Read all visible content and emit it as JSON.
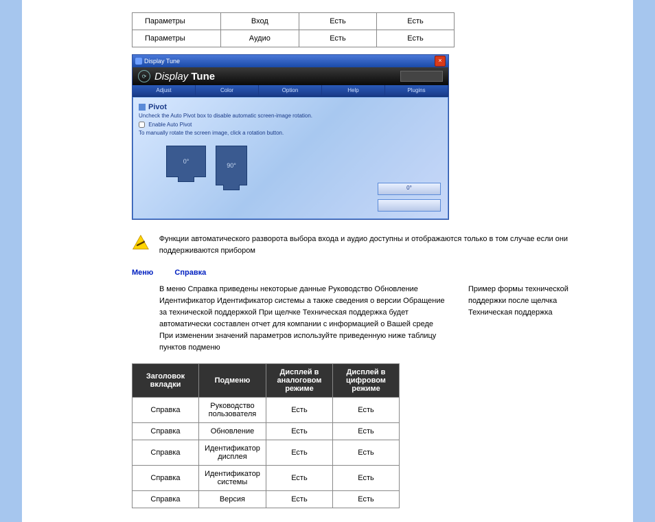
{
  "table1": {
    "rows": [
      {
        "c0": "Параметры",
        "c1": "Вход",
        "c2": "Есть",
        "c3": "Есть"
      },
      {
        "c0": "Параметры",
        "c1": "Аудио",
        "c2": "Есть",
        "c3": "Есть"
      }
    ]
  },
  "app": {
    "title": "Display Tune",
    "brand_prefix": "Display",
    "brand_suffix": "Tune",
    "tabs": [
      "Adjust",
      "Color",
      "Option",
      "Help",
      "Plugins"
    ],
    "panel_title": "Pivot",
    "panel_desc": "Uncheck the Auto Pivot box to disable automatic screen-image rotation.",
    "checkbox": "Enable Auto Pivot",
    "panel_hint": "To manually rotate the screen image, click a rotation button.",
    "mon1": "0°",
    "mon2": "90°",
    "btn1": "0°",
    "btn2": ""
  },
  "warning": "Функции автоматического разворота  выбора входа и аудио доступны и отображаются только в том случае  если они поддерживаются прибором",
  "menu": {
    "m1": "Меню",
    "m2": "Справка"
  },
  "col_left": "В меню          Справка  приведены некоторые данные               Руководство              Обновление         Идентификатор         Идентификатор системы   а также сведения о версии   Обращение за технической поддержкой  При щелчке               Техническая поддержка  будет автоматически составлен отчет для компании          с информацией о Вашей среде   При изменении значений параметров используйте приведенную ниже таблицу пунктов подменю",
  "col_right": "Пример формы технической поддержки после щелчка                    Техническая поддержка",
  "table2": {
    "headers": [
      "Заголовок вкладки",
      "Подменю",
      "Дисплей в аналоговом режиме",
      "Дисплей в цифровом режиме"
    ],
    "rows": [
      {
        "c0": "Справка",
        "c1": "Руководство пользователя",
        "c2": "Есть",
        "c3": "Есть"
      },
      {
        "c0": "Справка",
        "c1": "Обновление",
        "c2": "Есть",
        "c3": "Есть"
      },
      {
        "c0": "Справка",
        "c1": "Идентификатор дисплея",
        "c2": "Есть",
        "c3": "Есть"
      },
      {
        "c0": "Справка",
        "c1": "Идентификатор системы",
        "c2": "Есть",
        "c3": "Есть"
      },
      {
        "c0": "Справка",
        "c1": "Версия",
        "c2": "Есть",
        "c3": "Есть"
      }
    ]
  }
}
